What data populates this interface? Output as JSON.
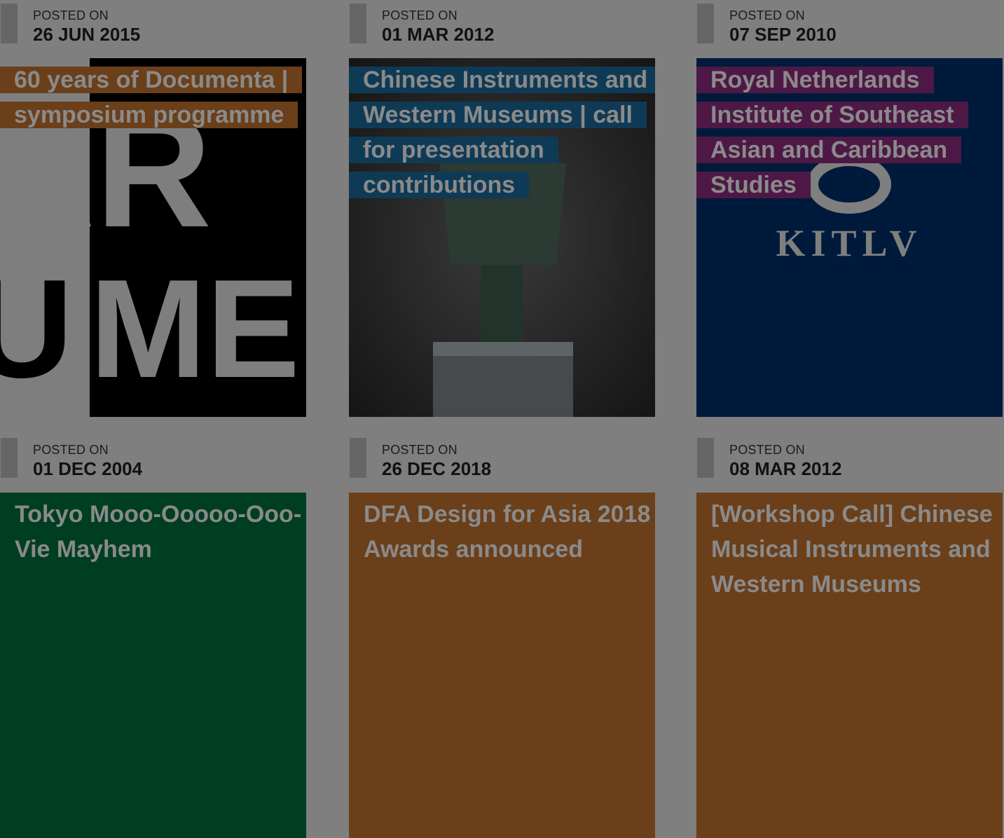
{
  "posts": [
    {
      "posted_label": "POSTED ON",
      "date": "26 JUN 2015",
      "title": "60 years of Documenta | symposium programme",
      "title_bg": "#6b3f1a",
      "thumb": "documenta-poster-image"
    },
    {
      "posted_label": "POSTED ON",
      "date": "01 MAR 2012",
      "title": "Chinese Instruments and Western Museums | call for presentation contributions",
      "title_bg": "#0f3a55",
      "thumb": "bronze-bell-image"
    },
    {
      "posted_label": "POSTED ON",
      "date": "07 SEP 2010",
      "title": "Royal Netherlands Institute of Southeast Asian and Caribbean Studies",
      "title_bg": "#4e1846",
      "thumb": "kitlv-logo-image",
      "logo_text": "KITLV"
    },
    {
      "posted_label": "POSTED ON",
      "date": "01 DEC 2004",
      "title": "Tokyo Mooo-Ooooo-Ooo-Vie Mayhem",
      "title_bg": "#003e22"
    },
    {
      "posted_label": "POSTED ON",
      "date": "26 DEC 2018",
      "title": "DFA Design for Asia 2018 Awards announced",
      "title_bg": "#6b3f1a"
    },
    {
      "posted_label": "POSTED ON",
      "date": "08 MAR 2012",
      "title": "[Workshop Call] Chinese Musical Instruments and Western Museums",
      "title_bg": "#6b3f1a"
    }
  ]
}
